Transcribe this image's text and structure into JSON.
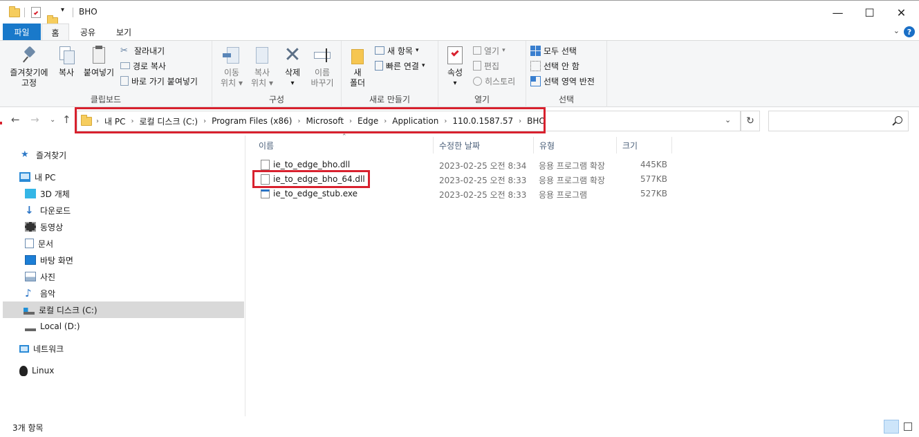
{
  "window": {
    "title": "BHO",
    "minimize": "—",
    "maximize": "☐",
    "close": "✕"
  },
  "tabs": {
    "file": "파일",
    "home": "홈",
    "share": "공유",
    "view": "보기",
    "help": "?"
  },
  "ribbon": {
    "clipboard": {
      "label": "클립보드",
      "pin_line1": "즐겨찾기에",
      "pin_line2": "고정",
      "copy": "복사",
      "paste": "붙여넣기",
      "cut": "잘라내기",
      "copy_path": "경로 복사",
      "paste_shortcut": "바로 가기 붙여넣기"
    },
    "organize": {
      "label": "구성",
      "move_line1": "이동",
      "move_line2": "위치",
      "copyto_line1": "복사",
      "copyto_line2": "위치",
      "delete": "삭제",
      "rename_line1": "이름",
      "rename_line2": "바꾸기"
    },
    "new": {
      "label": "새로 만들기",
      "folder_line1": "새",
      "folder_line2": "폴더",
      "new_item": "새 항목",
      "easy_access": "빠른 연결"
    },
    "open": {
      "label": "열기",
      "properties": "속성",
      "open": "열기",
      "edit": "편집",
      "history": "히스토리"
    },
    "select": {
      "label": "선택",
      "select_all": "모두 선택",
      "select_none": "선택 안 함",
      "invert": "선택 영역 반전"
    }
  },
  "address": {
    "crumbs": [
      "내 PC",
      "로컬 디스크 (C:)",
      "Program Files (x86)",
      "Microsoft",
      "Edge",
      "Application",
      "110.0.1587.57",
      "BHO"
    ]
  },
  "nav": {
    "quick_access": "즐겨찾기",
    "this_pc": "내 PC",
    "objects3d": "3D 개체",
    "downloads": "다운로드",
    "videos": "동영상",
    "documents": "문서",
    "desktop": "바탕 화면",
    "pictures": "사진",
    "music": "음악",
    "local_c": "로컬 디스크 (C:)",
    "local_d": "Local (D:)",
    "network": "네트워크",
    "linux": "Linux"
  },
  "columns": {
    "name": "이름",
    "date": "수정한 날짜",
    "type": "유형",
    "size": "크기"
  },
  "files": [
    {
      "name": "ie_to_edge_bho.dll",
      "date": "2023-02-25 오전 8:34",
      "type": "응용 프로그램 확장",
      "size": "445KB"
    },
    {
      "name": "ie_to_edge_bho_64.dll",
      "date": "2023-02-25 오전 8:33",
      "type": "응용 프로그램 확장",
      "size": "577KB"
    },
    {
      "name": "ie_to_edge_stub.exe",
      "date": "2023-02-25 오전 8:33",
      "type": "응용 프로그램",
      "size": "527KB"
    }
  ],
  "status": {
    "count": "3개 항목"
  },
  "colors": {
    "accent": "#1979ca",
    "highlight": "#d8212e",
    "selection": "#d9d9d9"
  }
}
